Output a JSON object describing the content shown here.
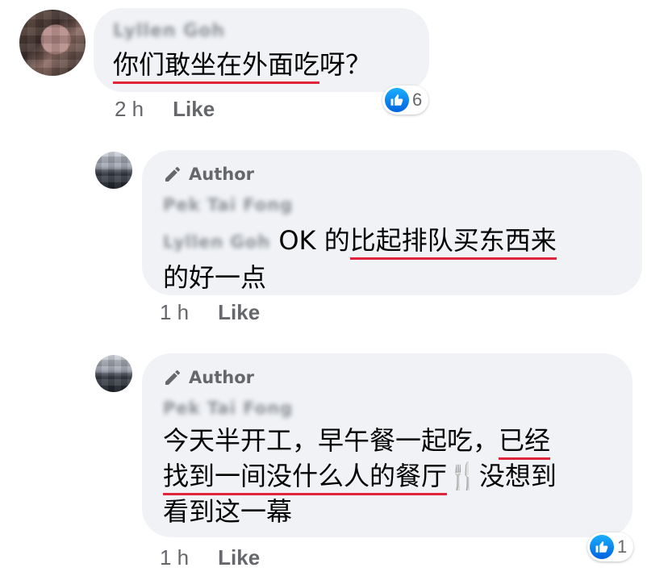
{
  "comments": [
    {
      "author_name": "Lyllen Goh",
      "text_parts": [
        "",
        "你们敢坐在外面吃",
        "呀？"
      ],
      "time": "2 h",
      "like_label": "Like",
      "reaction_count": "6",
      "avatar_icon": "profile-photo"
    }
  ],
  "replies": [
    {
      "badge_label": "Author",
      "author_name": "Pek Tai Fong",
      "mention": "Lyllen Goh",
      "line1_plain": " OK 的",
      "line1_underlined": "比起排队买东西来",
      "line2": "的好一点",
      "time": "1 h",
      "like_label": "Like"
    },
    {
      "badge_label": "Author",
      "author_name": "Pek Tai Fong",
      "line1_plain": "今天半开工，早午餐一起吃，",
      "line1_underlined": "已经",
      "line2_underlined": "找到一间没什么人的餐厅",
      "line2_emoji": "🍴",
      "line2_plain": "没想到",
      "line3": "看到这一幕",
      "time": "1 h",
      "like_label": "Like",
      "reaction_count": "1"
    }
  ],
  "icons": {
    "author_badge": "pencil-icon",
    "reaction": "thumbs-up-icon"
  },
  "colors": {
    "bubble": "#f0f2f5",
    "meta_text": "#65676b",
    "underline": "#e0253a",
    "like_blue": "#1877f2"
  }
}
